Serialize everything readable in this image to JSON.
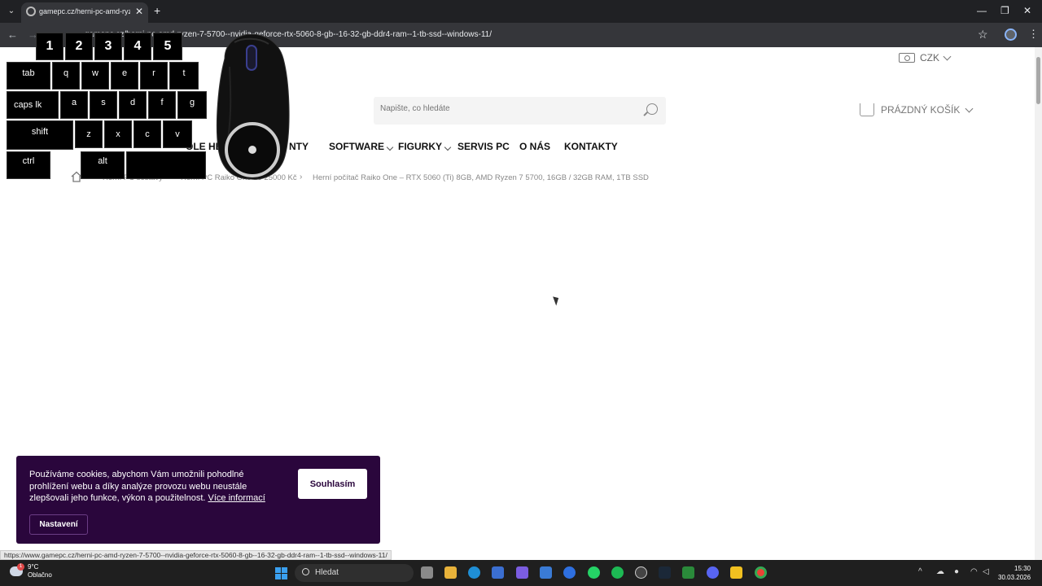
{
  "browser": {
    "tab_title": "gamepc.cz/herni-pc-amd-ryzen",
    "url": "gamepc.cz/herni-pc-amd-ryzen-7-5700--nvidia-geforce-rtx-5060-8-gb--16-32-gb-ddr4-ram--1-tb-ssd--windows-11/",
    "status_url": "https://www.gamepc.cz/herni-pc-amd-ryzen-7-5700--nvidia-geforce-rtx-5060-8-gb--16-32-gb-ddr4-ram--1-tb-ssd--windows-11/"
  },
  "header": {
    "currency": "CZK",
    "search_placeholder": "Napište, co hledáte",
    "cart_label": "PRÁZDNÝ KOŠÍK"
  },
  "nav": {
    "partial_1": "OLE HE",
    "partial_2": "NTY",
    "software": "SOFTWARE",
    "figurky": "FIGURKY",
    "servis": "SERVIS PC",
    "onas": "O NÁS",
    "kontakty": "KONTAKTY"
  },
  "breadcrumb": {
    "item1": "Herní PC sestavy",
    "item2": "Herní PC Raiko One do 25000 Kč",
    "current": "Herní počítač Raiko One – RTX 5060 (Ti) 8GB, AMD Ryzen 7 5700, 16GB / 32GB RAM, 1TB SSD"
  },
  "keyboard_overlay": {
    "numbers": [
      "1",
      "2",
      "3",
      "4",
      "5"
    ],
    "row1": [
      "tab",
      "q",
      "w",
      "e",
      "r",
      "t"
    ],
    "row2": [
      "caps lk",
      "a",
      "s",
      "d",
      "f",
      "g"
    ],
    "row3": [
      "shift",
      "z",
      "x",
      "c",
      "v"
    ],
    "row4": [
      "ctrl",
      "alt",
      ""
    ]
  },
  "cookie": {
    "text": "Používáme cookies, abychom Vám umožnili pohodlné prohlížení webu a díky analýze provozu webu neustále zlepšovali jeho funkce, výkon a použitelnost.",
    "link": "Více informací",
    "agree_button": "Souhlasím",
    "settings_button": "Nastavení"
  },
  "taskbar": {
    "temperature": "9°C",
    "weather": "Oblačno",
    "weather_badge": "1",
    "search_label": "Hledat",
    "time": "15:30",
    "date": "30.03.2026"
  },
  "colors": {
    "cookie_bg": "#2a063c",
    "chrome_dark": "#202124"
  }
}
